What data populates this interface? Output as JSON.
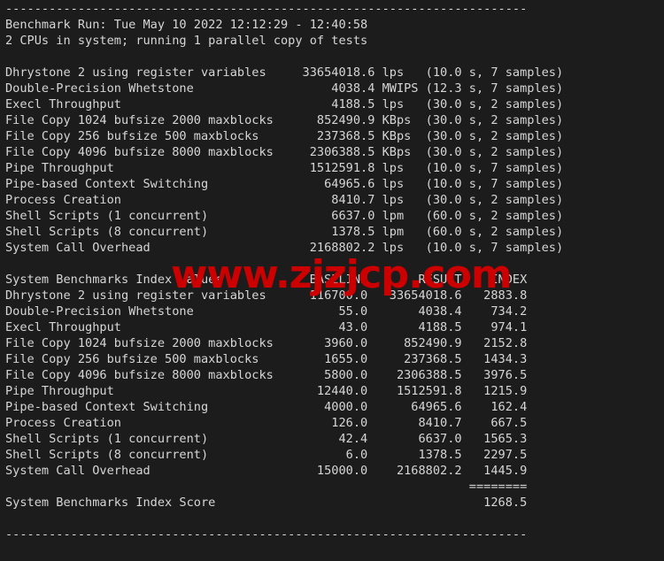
{
  "terminal": {
    "background_color": "#1c1c1c",
    "text_color": "#d6d6d6",
    "watermark": {
      "text": "www.zjzjcp.com",
      "color": "#cc0000"
    }
  },
  "report": {
    "rule_top": "------------------------------------------------------------------------",
    "rule_bottom": "------------------------------------------------------------------------",
    "run_header": "Benchmark Run: Tue May 10 2022 12:12:29 - 12:40:58",
    "cpu_line": "2 CPUs in system; running 1 parallel copy of tests",
    "results_section": {
      "rows": [
        {
          "name": "Dhrystone 2 using register variables",
          "value": "33654018.6",
          "unit": "lps",
          "duration": "10.0",
          "samples": "7"
        },
        {
          "name": "Double-Precision Whetstone",
          "value": "4038.4",
          "unit": "MWIPS",
          "duration": "12.3",
          "samples": "7"
        },
        {
          "name": "Execl Throughput",
          "value": "4188.5",
          "unit": "lps",
          "duration": "30.0",
          "samples": "2"
        },
        {
          "name": "File Copy 1024 bufsize 2000 maxblocks",
          "value": "852490.9",
          "unit": "KBps",
          "duration": "30.0",
          "samples": "2"
        },
        {
          "name": "File Copy 256 bufsize 500 maxblocks",
          "value": "237368.5",
          "unit": "KBps",
          "duration": "30.0",
          "samples": "2"
        },
        {
          "name": "File Copy 4096 bufsize 8000 maxblocks",
          "value": "2306388.5",
          "unit": "KBps",
          "duration": "30.0",
          "samples": "2"
        },
        {
          "name": "Pipe Throughput",
          "value": "1512591.8",
          "unit": "lps",
          "duration": "10.0",
          "samples": "7"
        },
        {
          "name": "Pipe-based Context Switching",
          "value": "64965.6",
          "unit": "lps",
          "duration": "10.0",
          "samples": "7"
        },
        {
          "name": "Process Creation",
          "value": "8410.7",
          "unit": "lps",
          "duration": "30.0",
          "samples": "2"
        },
        {
          "name": "Shell Scripts (1 concurrent)",
          "value": "6637.0",
          "unit": "lpm",
          "duration": "60.0",
          "samples": "2"
        },
        {
          "name": "Shell Scripts (8 concurrent)",
          "value": "1378.5",
          "unit": "lpm",
          "duration": "60.0",
          "samples": "2"
        },
        {
          "name": "System Call Overhead",
          "value": "2168802.2",
          "unit": "lps",
          "duration": "10.0",
          "samples": "7"
        }
      ]
    },
    "index_section": {
      "title": "System Benchmarks Index Values",
      "columns": [
        "BASELINE",
        "RESULT",
        "INDEX"
      ],
      "rows": [
        {
          "name": "Dhrystone 2 using register variables",
          "baseline": "116700.0",
          "result": "33654018.6",
          "index": "2883.8"
        },
        {
          "name": "Double-Precision Whetstone",
          "baseline": "55.0",
          "result": "4038.4",
          "index": "734.2"
        },
        {
          "name": "Execl Throughput",
          "baseline": "43.0",
          "result": "4188.5",
          "index": "974.1"
        },
        {
          "name": "File Copy 1024 bufsize 2000 maxblocks",
          "baseline": "3960.0",
          "result": "852490.9",
          "index": "2152.8"
        },
        {
          "name": "File Copy 256 bufsize 500 maxblocks",
          "baseline": "1655.0",
          "result": "237368.5",
          "index": "1434.3"
        },
        {
          "name": "File Copy 4096 bufsize 8000 maxblocks",
          "baseline": "5800.0",
          "result": "2306388.5",
          "index": "3976.5"
        },
        {
          "name": "Pipe Throughput",
          "baseline": "12440.0",
          "result": "1512591.8",
          "index": "1215.9"
        },
        {
          "name": "Pipe-based Context Switching",
          "baseline": "4000.0",
          "result": "64965.6",
          "index": "162.4"
        },
        {
          "name": "Process Creation",
          "baseline": "126.0",
          "result": "8410.7",
          "index": "667.5"
        },
        {
          "name": "Shell Scripts (1 concurrent)",
          "baseline": "42.4",
          "result": "6637.0",
          "index": "1565.3"
        },
        {
          "name": "Shell Scripts (8 concurrent)",
          "baseline": "6.0",
          "result": "1378.5",
          "index": "2297.5"
        },
        {
          "name": "System Call Overhead",
          "baseline": "15000.0",
          "result": "2168802.2",
          "index": "1445.9"
        }
      ],
      "score_separator": "========",
      "score_label": "System Benchmarks Index Score",
      "score_value": "1268.5"
    }
  }
}
